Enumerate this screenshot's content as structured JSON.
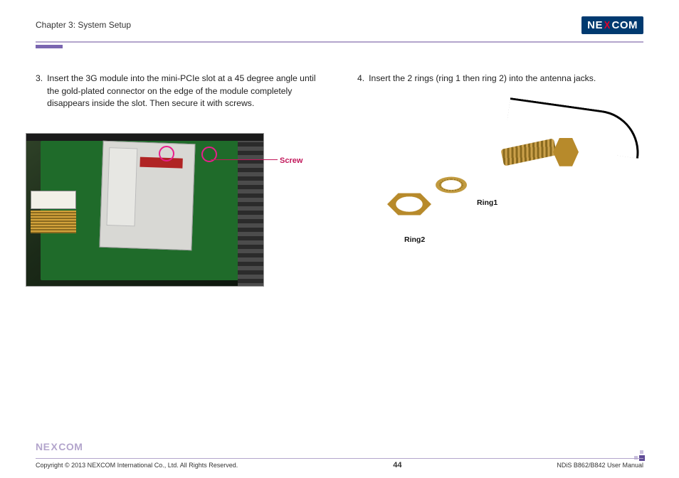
{
  "header": {
    "chapter": "Chapter 3: System Setup",
    "logo_parts": {
      "ne": "NE",
      "x": "X",
      "com": "COM"
    }
  },
  "steps": {
    "left": {
      "num": "3.",
      "text": "Insert the 3G module into the mini-PCIe slot at a 45 degree angle until the gold-plated connector on the edge of the module completely disappears inside the slot. Then secure it with screws."
    },
    "right": {
      "num": "4.",
      "text": "Insert the 2 rings (ring 1 then ring 2) into the antenna jacks."
    }
  },
  "labels": {
    "screw": "Screw",
    "ring1": "Ring1",
    "ring2": "Ring2"
  },
  "footer": {
    "copyright": "Copyright © 2013 NEXCOM International Co., Ltd. All Rights Reserved.",
    "page": "44",
    "doc": "NDiS B862/B842 User Manual",
    "logo_parts": {
      "ne": "NE",
      "x": "X",
      "com": "COM"
    }
  }
}
